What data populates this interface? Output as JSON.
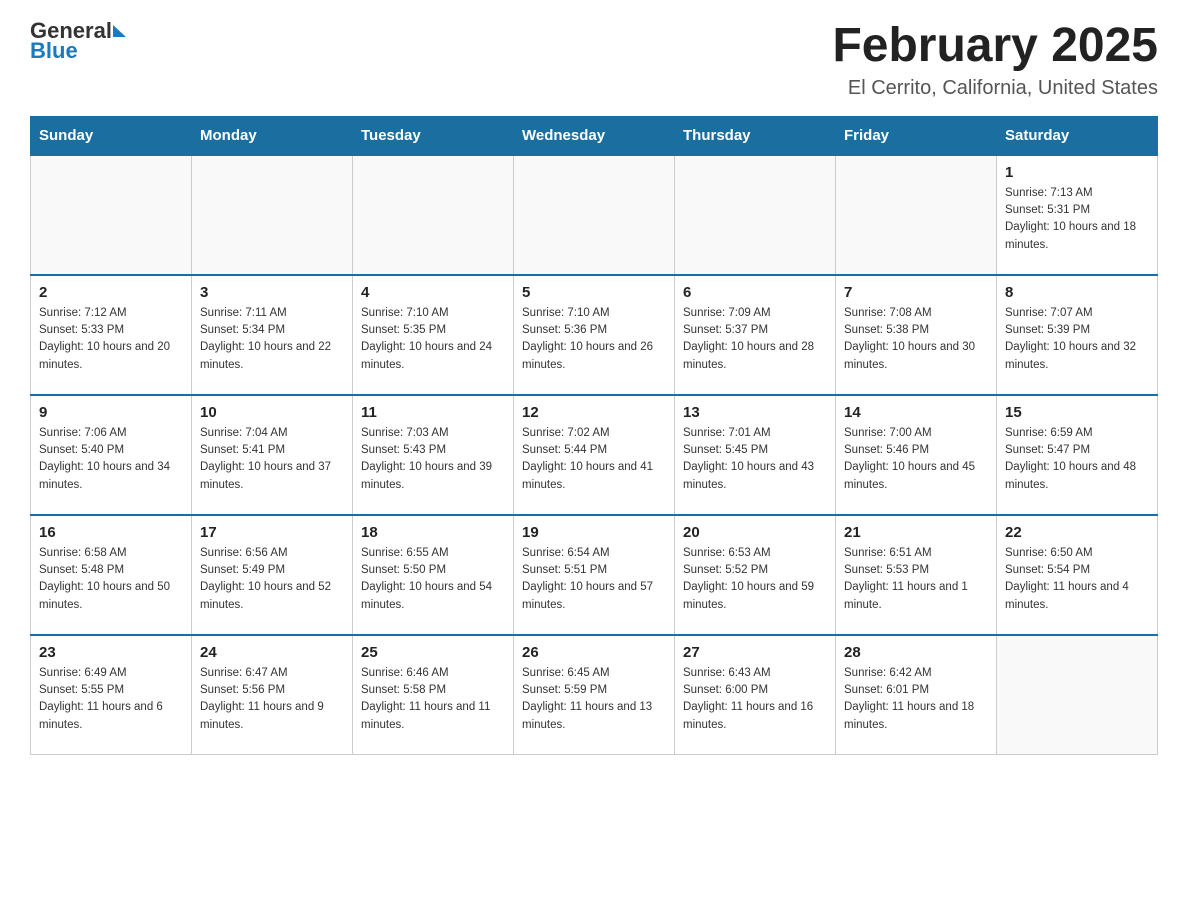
{
  "header": {
    "logo_general": "General",
    "logo_blue": "Blue",
    "title": "February 2025",
    "subtitle": "El Cerrito, California, United States"
  },
  "calendar": {
    "weekdays": [
      "Sunday",
      "Monday",
      "Tuesday",
      "Wednesday",
      "Thursday",
      "Friday",
      "Saturday"
    ],
    "weeks": [
      [
        {
          "day": "",
          "info": ""
        },
        {
          "day": "",
          "info": ""
        },
        {
          "day": "",
          "info": ""
        },
        {
          "day": "",
          "info": ""
        },
        {
          "day": "",
          "info": ""
        },
        {
          "day": "",
          "info": ""
        },
        {
          "day": "1",
          "info": "Sunrise: 7:13 AM\nSunset: 5:31 PM\nDaylight: 10 hours and 18 minutes."
        }
      ],
      [
        {
          "day": "2",
          "info": "Sunrise: 7:12 AM\nSunset: 5:33 PM\nDaylight: 10 hours and 20 minutes."
        },
        {
          "day": "3",
          "info": "Sunrise: 7:11 AM\nSunset: 5:34 PM\nDaylight: 10 hours and 22 minutes."
        },
        {
          "day": "4",
          "info": "Sunrise: 7:10 AM\nSunset: 5:35 PM\nDaylight: 10 hours and 24 minutes."
        },
        {
          "day": "5",
          "info": "Sunrise: 7:10 AM\nSunset: 5:36 PM\nDaylight: 10 hours and 26 minutes."
        },
        {
          "day": "6",
          "info": "Sunrise: 7:09 AM\nSunset: 5:37 PM\nDaylight: 10 hours and 28 minutes."
        },
        {
          "day": "7",
          "info": "Sunrise: 7:08 AM\nSunset: 5:38 PM\nDaylight: 10 hours and 30 minutes."
        },
        {
          "day": "8",
          "info": "Sunrise: 7:07 AM\nSunset: 5:39 PM\nDaylight: 10 hours and 32 minutes."
        }
      ],
      [
        {
          "day": "9",
          "info": "Sunrise: 7:06 AM\nSunset: 5:40 PM\nDaylight: 10 hours and 34 minutes."
        },
        {
          "day": "10",
          "info": "Sunrise: 7:04 AM\nSunset: 5:41 PM\nDaylight: 10 hours and 37 minutes."
        },
        {
          "day": "11",
          "info": "Sunrise: 7:03 AM\nSunset: 5:43 PM\nDaylight: 10 hours and 39 minutes."
        },
        {
          "day": "12",
          "info": "Sunrise: 7:02 AM\nSunset: 5:44 PM\nDaylight: 10 hours and 41 minutes."
        },
        {
          "day": "13",
          "info": "Sunrise: 7:01 AM\nSunset: 5:45 PM\nDaylight: 10 hours and 43 minutes."
        },
        {
          "day": "14",
          "info": "Sunrise: 7:00 AM\nSunset: 5:46 PM\nDaylight: 10 hours and 45 minutes."
        },
        {
          "day": "15",
          "info": "Sunrise: 6:59 AM\nSunset: 5:47 PM\nDaylight: 10 hours and 48 minutes."
        }
      ],
      [
        {
          "day": "16",
          "info": "Sunrise: 6:58 AM\nSunset: 5:48 PM\nDaylight: 10 hours and 50 minutes."
        },
        {
          "day": "17",
          "info": "Sunrise: 6:56 AM\nSunset: 5:49 PM\nDaylight: 10 hours and 52 minutes."
        },
        {
          "day": "18",
          "info": "Sunrise: 6:55 AM\nSunset: 5:50 PM\nDaylight: 10 hours and 54 minutes."
        },
        {
          "day": "19",
          "info": "Sunrise: 6:54 AM\nSunset: 5:51 PM\nDaylight: 10 hours and 57 minutes."
        },
        {
          "day": "20",
          "info": "Sunrise: 6:53 AM\nSunset: 5:52 PM\nDaylight: 10 hours and 59 minutes."
        },
        {
          "day": "21",
          "info": "Sunrise: 6:51 AM\nSunset: 5:53 PM\nDaylight: 11 hours and 1 minute."
        },
        {
          "day": "22",
          "info": "Sunrise: 6:50 AM\nSunset: 5:54 PM\nDaylight: 11 hours and 4 minutes."
        }
      ],
      [
        {
          "day": "23",
          "info": "Sunrise: 6:49 AM\nSunset: 5:55 PM\nDaylight: 11 hours and 6 minutes."
        },
        {
          "day": "24",
          "info": "Sunrise: 6:47 AM\nSunset: 5:56 PM\nDaylight: 11 hours and 9 minutes."
        },
        {
          "day": "25",
          "info": "Sunrise: 6:46 AM\nSunset: 5:58 PM\nDaylight: 11 hours and 11 minutes."
        },
        {
          "day": "26",
          "info": "Sunrise: 6:45 AM\nSunset: 5:59 PM\nDaylight: 11 hours and 13 minutes."
        },
        {
          "day": "27",
          "info": "Sunrise: 6:43 AM\nSunset: 6:00 PM\nDaylight: 11 hours and 16 minutes."
        },
        {
          "day": "28",
          "info": "Sunrise: 6:42 AM\nSunset: 6:01 PM\nDaylight: 11 hours and 18 minutes."
        },
        {
          "day": "",
          "info": ""
        }
      ]
    ]
  }
}
